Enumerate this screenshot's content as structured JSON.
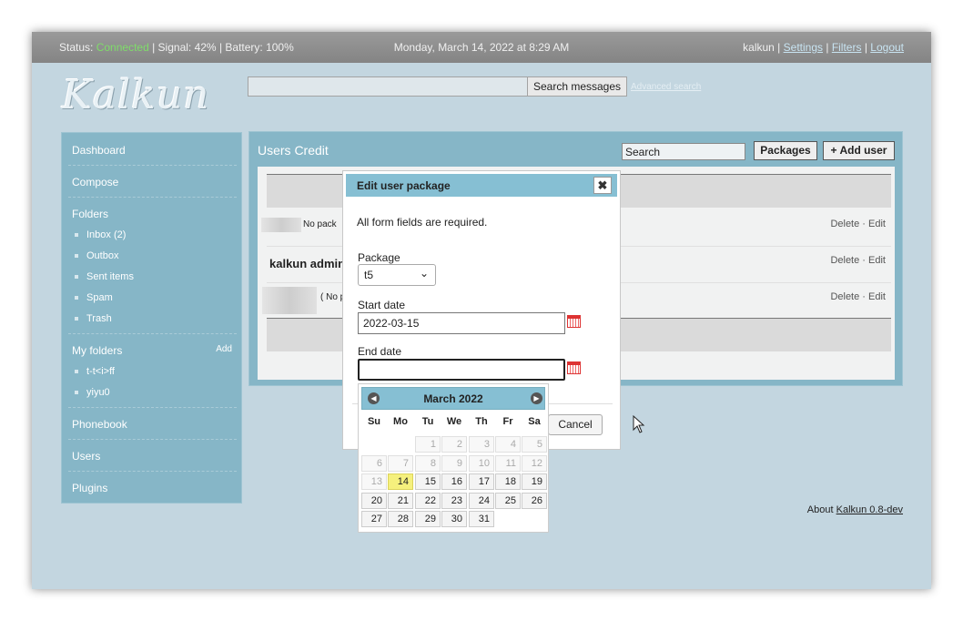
{
  "topbar": {
    "status_label": "Status:",
    "status_value": "Connected",
    "signal": "| Signal: 42%",
    "battery": "| Battery: 100%",
    "datetime": "Monday, March 14, 2022 at 8:29 AM",
    "user": "kalkun",
    "settings": "Settings",
    "filters": "Filters",
    "logout": "Logout",
    "sep": "|"
  },
  "logo": "Kalkun",
  "search": {
    "placeholder": "",
    "button": "Search messages",
    "advanced": "Advanced search"
  },
  "sidebar": {
    "dashboard": "Dashboard",
    "compose": "Compose",
    "folders": "Folders",
    "folder_items": [
      "Inbox (2)",
      "Outbox",
      "Sent items",
      "Spam",
      "Trash"
    ],
    "my_folders": "My folders",
    "add": "Add",
    "my_folder_items": [
      "t-t<i>ff",
      "yiyu0"
    ],
    "phonebook": "Phonebook",
    "users": "Users",
    "plugins": "Plugins"
  },
  "panel": {
    "title": "Users Credit",
    "search_value": "Search",
    "packages": "Packages",
    "add_user": "+ Add user",
    "rows": [
      {
        "text": "No pack",
        "delete": "Delete",
        "edit": "Edit"
      },
      {
        "text": "kalkun admin",
        "delete": "Delete",
        "edit": "Edit"
      },
      {
        "text": "( No p",
        "delete": "Delete",
        "edit": "Edit"
      }
    ],
    "dot": "·"
  },
  "about": {
    "prefix": "About",
    "link": "Kalkun 0.8-dev"
  },
  "dialog": {
    "title": "Edit user package",
    "close": "✖",
    "required": "All form fields are required.",
    "package_label": "Package",
    "package_value": "t5",
    "start_label": "Start date",
    "start_value": "2022-03-15",
    "end_label": "End date",
    "end_value": "",
    "cancel": "Cancel"
  },
  "calendar": {
    "title": "March 2022",
    "prev": "◀",
    "next": "▶",
    "weekdays": [
      "Su",
      "Mo",
      "Tu",
      "We",
      "Th",
      "Fr",
      "Sa"
    ],
    "weeks": [
      [
        "",
        "",
        "1",
        "2",
        "3",
        "4",
        "5"
      ],
      [
        "6",
        "7",
        "8",
        "9",
        "10",
        "11",
        "12"
      ],
      [
        "13",
        "14",
        "15",
        "16",
        "17",
        "18",
        "19"
      ],
      [
        "20",
        "21",
        "22",
        "23",
        "24",
        "25",
        "26"
      ],
      [
        "27",
        "28",
        "29",
        "30",
        "31",
        "",
        ""
      ]
    ],
    "today": "14",
    "min_enabled": 14
  }
}
